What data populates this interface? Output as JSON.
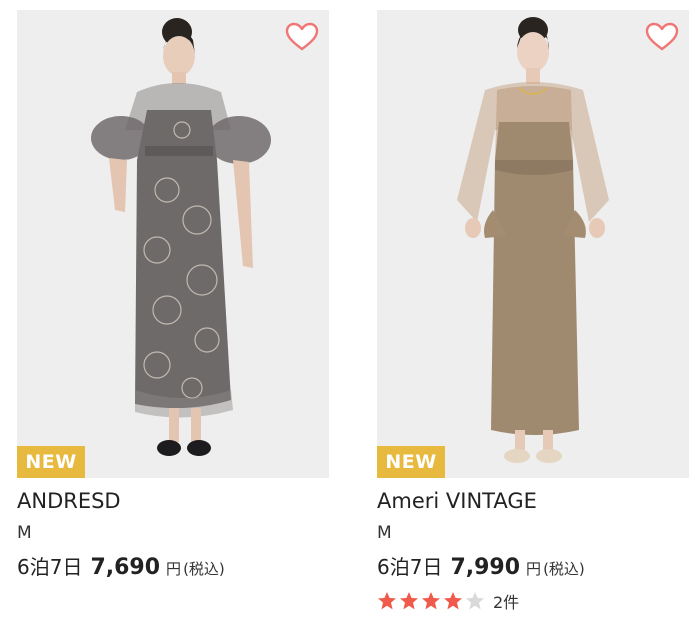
{
  "colors": {
    "badge": "#e8b93f",
    "heart": "#f07676",
    "star_on": "#ef5a4a",
    "star_off": "#d9d9d9"
  },
  "products": [
    {
      "badge": "NEW",
      "brand": "ANDRESD",
      "size": "M",
      "plan": "6泊7日",
      "price": "7,690",
      "currency": "円",
      "tax_note": "(税込)",
      "favorite_icon": "heart-outline-icon"
    },
    {
      "badge": "NEW",
      "brand": "Ameri VINTAGE",
      "size": "M",
      "plan": "6泊7日",
      "price": "7,990",
      "currency": "円",
      "tax_note": "(税込)",
      "favorite_icon": "heart-outline-icon",
      "rating": 4,
      "rating_max": 5,
      "review_count": "2件"
    }
  ]
}
